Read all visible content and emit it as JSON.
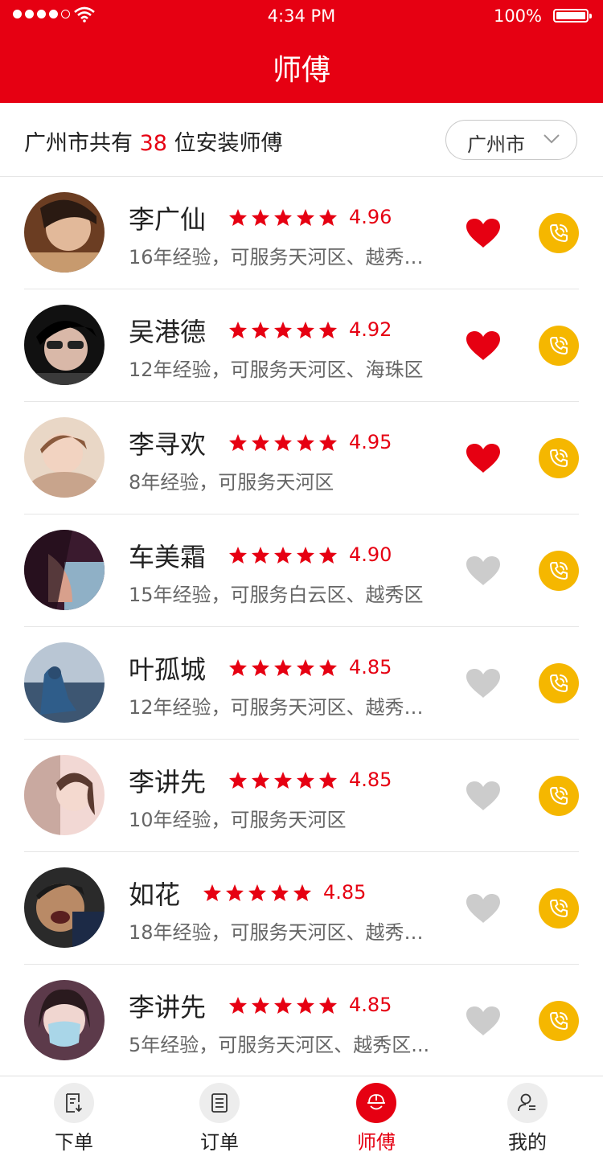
{
  "status_bar": {
    "time": "4:34 PM",
    "battery": "100%"
  },
  "header": {
    "title": "师傅"
  },
  "summary": {
    "prefix": "广州市共有",
    "count": "38",
    "suffix": "位安装师傅",
    "city": "广州市"
  },
  "colors": {
    "brand": "#e60012",
    "phone": "#f5b700",
    "heart_inactive": "#cccccc"
  },
  "technicians": [
    {
      "name": "李广仙",
      "rating": "4.96",
      "desc": "16年经验，可服务天河区、越秀区...",
      "favorited": true
    },
    {
      "name": "吴港德",
      "rating": "4.92",
      "desc": "12年经验，可服务天河区、海珠区",
      "favorited": true
    },
    {
      "name": "李寻欢",
      "rating": "4.95",
      "desc": "8年经验，可服务天河区",
      "favorited": true
    },
    {
      "name": "车美霜",
      "rating": "4.90",
      "desc": "15年经验，可服务白云区、越秀区",
      "favorited": false
    },
    {
      "name": "叶孤城",
      "rating": "4.85",
      "desc": "12年经验，可服务天河区、越秀区...",
      "favorited": false
    },
    {
      "name": "李讲先",
      "rating": "4.85",
      "desc": "10年经验，可服务天河区",
      "favorited": false
    },
    {
      "name": "如花",
      "rating": "4.85",
      "desc": "18年经验，可服务天河区、越秀区...",
      "favorited": false
    },
    {
      "name": "李讲先",
      "rating": "4.85",
      "desc": "5年经验，可服务天河区、越秀区...",
      "favorited": false
    }
  ],
  "tabs": [
    {
      "label": "下单",
      "icon": "order-form-icon",
      "active": false
    },
    {
      "label": "订单",
      "icon": "orders-list-icon",
      "active": false
    },
    {
      "label": "师傅",
      "icon": "helmet-icon",
      "active": true
    },
    {
      "label": "我的",
      "icon": "profile-icon",
      "active": false
    }
  ]
}
